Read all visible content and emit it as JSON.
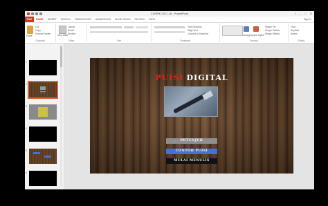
{
  "titlebar": {
    "title": "CLERIK 2017-18 - PowerPoint",
    "window_buttons": [
      "?",
      "–",
      "□",
      "✕"
    ]
  },
  "menubar": {
    "file_label": "FILE",
    "tabs": [
      "HOME",
      "INSERT",
      "DESIGN",
      "TRANSITIONS",
      "ANIMATIONS",
      "SLIDE SHOW",
      "REVIEW",
      "VIEW"
    ],
    "active_tab": "HOME",
    "signin_label": "Sign in"
  },
  "ribbon": {
    "clipboard": {
      "label": "Clipboard",
      "paste": "Paste",
      "cut": "Cut",
      "copy": "Copy",
      "format_painter": "Format Painter"
    },
    "slides": {
      "label": "Slides",
      "new_slide": "New Slide",
      "layout": "Layout",
      "reset": "Reset",
      "section": "Section"
    },
    "font": {
      "label": "Font"
    },
    "paragraph": {
      "label": "Paragraph",
      "text_direction": "Text Direction",
      "align_text": "Align Text",
      "convert_smartart": "Convert to SmartArt"
    },
    "drawing": {
      "label": "Drawing",
      "arrange": "Arrange",
      "quick_styles": "Quick Styles",
      "shape_fill": "Shape Fill",
      "shape_outline": "Shape Outline",
      "shape_effects": "Shape Effects"
    },
    "editing": {
      "label": "Editing",
      "find": "Find",
      "replace": "Replace",
      "select": "Select"
    }
  },
  "thumbnails": [
    {
      "number": "1",
      "selected": false
    },
    {
      "number": "2",
      "selected": true
    },
    {
      "number": "3",
      "selected": false
    },
    {
      "number": "4",
      "selected": false
    },
    {
      "number": "5",
      "selected": false
    },
    {
      "number": "6",
      "selected": false
    }
  ],
  "slide": {
    "title_word1": "PUISI",
    "title_word2": "DIGITAL",
    "buttons": {
      "petunjuk": "PETUNJUK",
      "contoh": "CONTOH PUISI",
      "mulai": "MULAI MENULIS"
    }
  },
  "colors": {
    "accent": "#c43e1c",
    "title_red": "#e2221d",
    "btn_gray": "#8f8f8f",
    "btn_blue": "#4a6fd0",
    "btn_black": "#111111"
  }
}
